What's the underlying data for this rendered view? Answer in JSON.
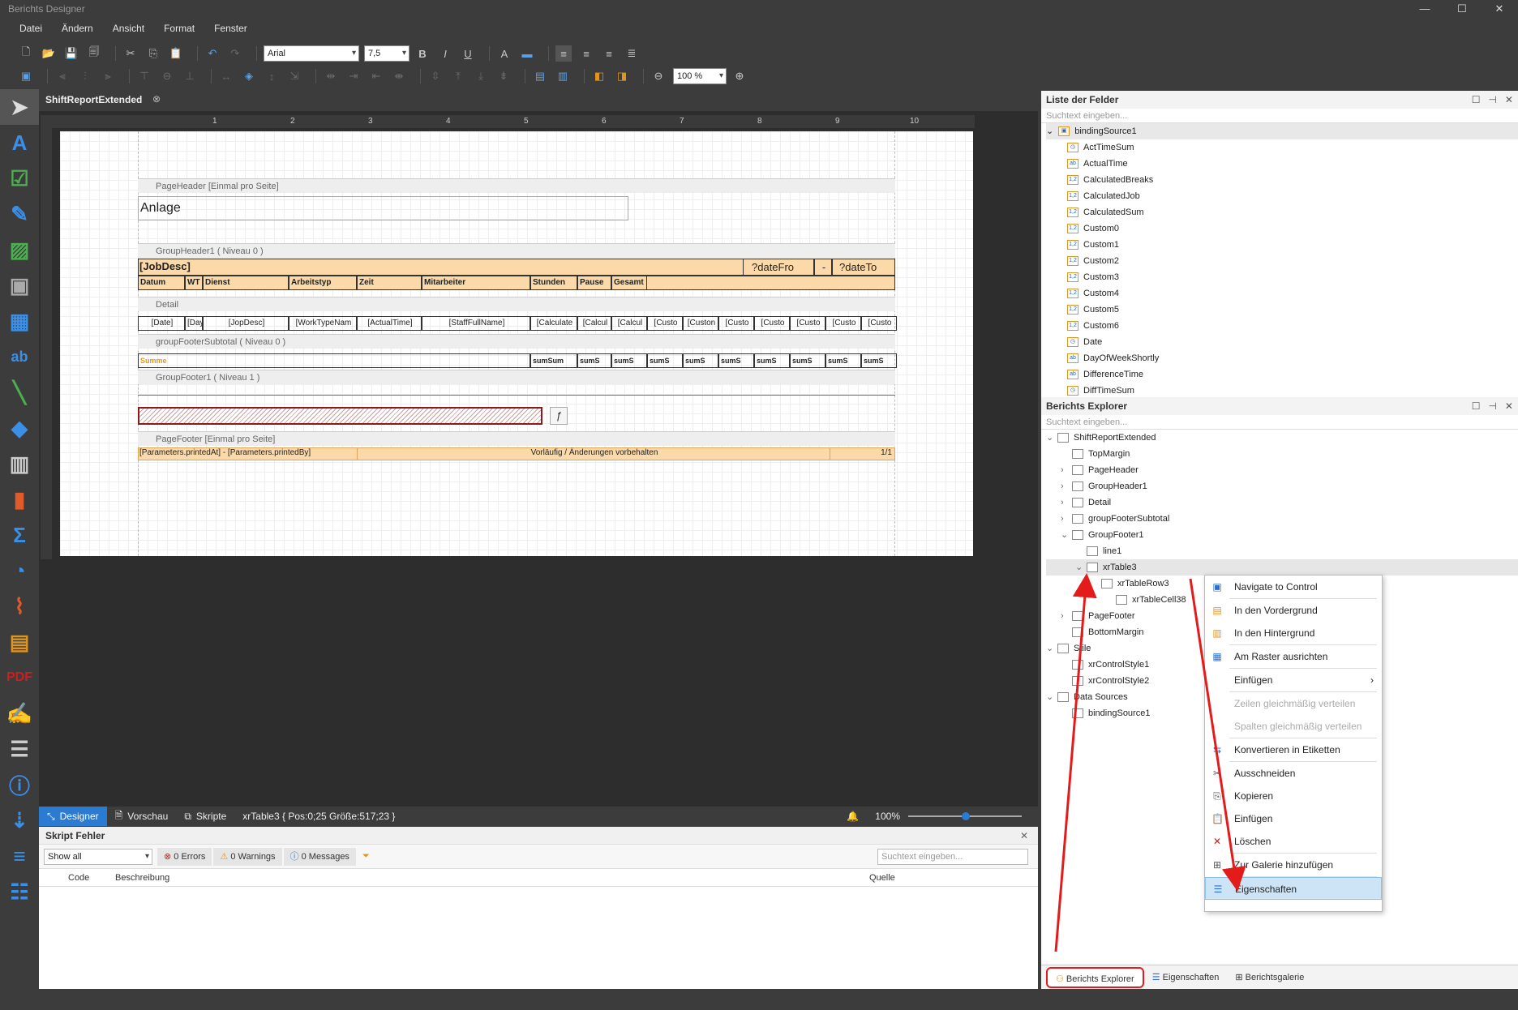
{
  "app": {
    "title": "Berichts Designer",
    "win_min": "—",
    "win_max": "☐",
    "win_close": "✕"
  },
  "menu": [
    "Datei",
    "Ändern",
    "Ansicht",
    "Format",
    "Fenster"
  ],
  "toolbar": {
    "font": "Arial",
    "size": "7,5",
    "zoom": "100 %"
  },
  "document": {
    "tab": "ShiftReportExtended",
    "close": "⊗"
  },
  "ruler": [
    "1",
    "2",
    "3",
    "4",
    "5",
    "6",
    "7",
    "8",
    "9",
    "10"
  ],
  "report": {
    "page_header": "PageHeader [Einmal pro Seite]",
    "anlage": "Anlage",
    "group_header": "GroupHeader1 ( Niveau 0 )",
    "job_desc": "[JobDesc]",
    "date_from": "?dateFro",
    "dash": "-",
    "date_to": "?dateTo",
    "columns": [
      "Datum",
      "WT",
      "Dienst",
      "Arbeitstyp",
      "Zeit",
      "Mitarbeiter",
      "Stunden",
      "Pause",
      "Gesamt"
    ],
    "detail": "Detail",
    "detail_cells": [
      "[Date]",
      "[Day",
      "[JopDesc]",
      "[WorkTypeNam",
      "[ActualTime]",
      "[StaffFullName]",
      "[Calculate",
      "[Calcul",
      "[Calcul",
      "[Custo",
      "[Custon",
      "[Custo",
      "[Custo",
      "[Custo",
      "[Custo",
      "[Custo"
    ],
    "group_footer_subtotal": "groupFooterSubtotal ( Niveau 0 )",
    "summe": "Summe",
    "sum_cells": [
      "sumSum",
      "sumS",
      "sumS",
      "sumS",
      "sumS",
      "sumS",
      "sumS",
      "sumS",
      "sumS",
      "sumS"
    ],
    "group_footer": "GroupFooter1 ( Niveau 1 )",
    "fx": "ƒ",
    "page_footer": "PageFooter [Einmal pro Seite]",
    "footer_left": "[Parameters.printedAt] - [Parameters.printedBy]",
    "footer_mid": "Vorläufig / Änderungen vorbehalten",
    "footer_right": "1/1"
  },
  "status": {
    "designer": "Designer",
    "preview": "Vorschau",
    "scripts": "Skripte",
    "info": "xrTable3 { Pos:0;25 Größe:517;23 }",
    "zoom": "100%"
  },
  "errors": {
    "title": "Skript Fehler",
    "filter": "Show all",
    "errors": "0 Errors",
    "warnings": "0 Warnings",
    "messages": "0 Messages",
    "search": "Suchtext eingeben...",
    "col_code": "Code",
    "col_desc": "Beschreibung",
    "col_source": "Quelle"
  },
  "fields": {
    "title": "Liste der Felder",
    "search": "Suchtext eingeben...",
    "root": "bindingSource1",
    "items": [
      {
        "name": "ActTimeSum",
        "ic": "◷"
      },
      {
        "name": "ActualTime",
        "ic": "ab"
      },
      {
        "name": "CalculatedBreaks",
        "ic": "1,2"
      },
      {
        "name": "CalculatedJob",
        "ic": "1,2"
      },
      {
        "name": "CalculatedSum",
        "ic": "1,2"
      },
      {
        "name": "Custom0",
        "ic": "1,2"
      },
      {
        "name": "Custom1",
        "ic": "1,2"
      },
      {
        "name": "Custom2",
        "ic": "1,2"
      },
      {
        "name": "Custom3",
        "ic": "1,2"
      },
      {
        "name": "Custom4",
        "ic": "1,2"
      },
      {
        "name": "Custom5",
        "ic": "1,2"
      },
      {
        "name": "Custom6",
        "ic": "1,2"
      },
      {
        "name": "Date",
        "ic": "◷"
      },
      {
        "name": "DayOfWeekShortly",
        "ic": "ab"
      },
      {
        "name": "DifferenceTime",
        "ic": "ab"
      },
      {
        "name": "DiffTimeSum",
        "ic": "◷"
      }
    ]
  },
  "explorer": {
    "title": "Berichts Explorer",
    "search": "Suchtext eingeben...",
    "items": [
      {
        "label": "ShiftReportExtended",
        "ind": 0,
        "exp": "⌄"
      },
      {
        "label": "TopMargin",
        "ind": 1,
        "exp": ""
      },
      {
        "label": "PageHeader",
        "ind": 1,
        "exp": "›"
      },
      {
        "label": "GroupHeader1",
        "ind": 1,
        "exp": "›"
      },
      {
        "label": "Detail",
        "ind": 1,
        "exp": "›"
      },
      {
        "label": "groupFooterSubtotal",
        "ind": 1,
        "exp": "›"
      },
      {
        "label": "GroupFooter1",
        "ind": 1,
        "exp": "⌄"
      },
      {
        "label": "line1",
        "ind": 2,
        "exp": ""
      },
      {
        "label": "xrTable3",
        "ind": 2,
        "exp": "⌄"
      },
      {
        "label": "xrTableRow3",
        "ind": 3,
        "exp": ""
      },
      {
        "label": "xrTableCell38",
        "ind": 4,
        "exp": ""
      },
      {
        "label": "PageFooter",
        "ind": 1,
        "exp": "›"
      },
      {
        "label": "BottomMargin",
        "ind": 1,
        "exp": ""
      },
      {
        "label": "Stile",
        "ind": 0,
        "exp": "⌄"
      },
      {
        "label": "xrControlStyle1",
        "ind": 1,
        "exp": ""
      },
      {
        "label": "xrControlStyle2",
        "ind": 1,
        "exp": ""
      },
      {
        "label": "Data Sources",
        "ind": 0,
        "exp": "⌄"
      },
      {
        "label": "bindingSource1",
        "ind": 1,
        "exp": ""
      }
    ]
  },
  "context_menu": [
    {
      "label": "Navigate to Control",
      "ic": "▣",
      "col": "#2b6fd0"
    },
    {
      "label": "In den Vordergrund",
      "ic": "▤",
      "col": "#e0961e"
    },
    {
      "label": "In den Hintergrund",
      "ic": "▥",
      "col": "#e0961e"
    },
    {
      "label": "Am Raster ausrichten",
      "ic": "▦",
      "col": "#2b6fd0"
    },
    {
      "label": "Einfügen",
      "ic": "",
      "col": "#333",
      "arrow": "›"
    },
    {
      "label": "Zeilen gleichmäßig verteilen",
      "ic": "",
      "col": "#aaa",
      "dis": true
    },
    {
      "label": "Spalten gleichmäßig verteilen",
      "ic": "",
      "col": "#aaa",
      "dis": true
    },
    {
      "label": "Konvertieren in Etiketten",
      "ic": "⇆",
      "col": "#2b6fd0"
    },
    {
      "label": "Ausschneiden",
      "ic": "✂",
      "col": "#555"
    },
    {
      "label": "Kopieren",
      "ic": "⎘",
      "col": "#555"
    },
    {
      "label": "Einfügen",
      "ic": "📋",
      "col": "#e0961e"
    },
    {
      "label": "Löschen",
      "ic": "✕",
      "col": "#d21c1c"
    },
    {
      "label": "Zur Galerie hinzufügen",
      "ic": "⊞",
      "col": "#555"
    },
    {
      "label": "Eigenschaften",
      "ic": "☰",
      "col": "#2b6fd0",
      "hl": true
    }
  ],
  "bottom_tabs": [
    "Berichts Explorer",
    "Eigenschaften",
    "Berichtsgalerie"
  ],
  "colors": {
    "accent": "#2b7bd3",
    "highlight": "#cde4f7",
    "arrow": "#e41b1b",
    "band_orange": "#fcd9a8"
  }
}
